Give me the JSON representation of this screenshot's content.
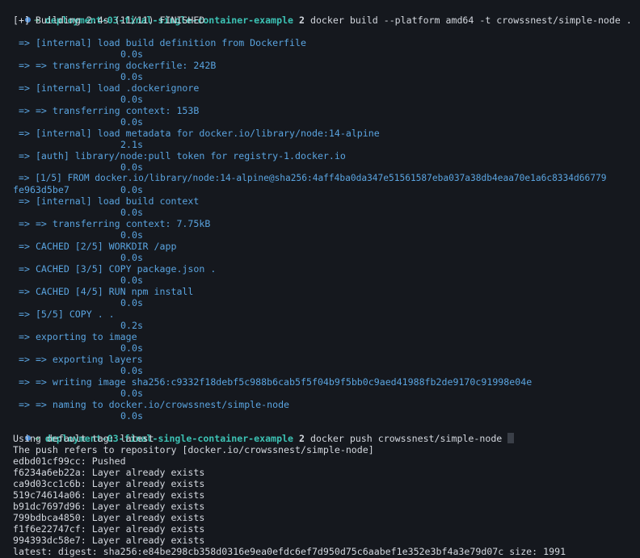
{
  "prompt1": {
    "arrow": "➜",
    "directory": "deployment-03-final-single-container-example",
    "git_branch_num": "2",
    "command": "docker build --platform amd64 -t crowssnest/simple-node ."
  },
  "build_status": "[+] Building 2.4s (11/11) FINISHED",
  "build_steps": [
    {
      "text": "=> [internal] load build definition from Dockerfile",
      "time": "0.0s"
    },
    {
      "text": "=> => transferring dockerfile: 242B",
      "time": "0.0s"
    },
    {
      "text": "=> [internal] load .dockerignore",
      "time": "0.0s"
    },
    {
      "text": "=> => transferring context: 153B",
      "time": "0.0s"
    },
    {
      "text": "=> [internal] load metadata for docker.io/library/node:14-alpine",
      "time": "2.1s"
    },
    {
      "text": "=> [auth] library/node:pull token for registry-1.docker.io",
      "time": "0.0s"
    },
    {
      "text": "=> [1/5] FROM docker.io/library/node:14-alpine@sha256:4aff4ba0da347e51561587eba037a38db4eaa70e1a6c8334d66779",
      "cont": "fe963d5be7",
      "time": "0.0s"
    },
    {
      "text": "=> [internal] load build context",
      "time": "0.0s"
    },
    {
      "text": "=> => transferring context: 7.75kB",
      "time": "0.0s"
    },
    {
      "text": "=> CACHED [2/5] WORKDIR /app",
      "time": "0.0s"
    },
    {
      "text": "=> CACHED [3/5] COPY package.json .",
      "time": "0.0s"
    },
    {
      "text": "=> CACHED [4/5] RUN npm install",
      "time": "0.0s"
    },
    {
      "text": "=> [5/5] COPY . .",
      "time": "0.2s"
    },
    {
      "text": "=> exporting to image",
      "time": "0.0s"
    },
    {
      "text": "=> => exporting layers",
      "time": "0.0s"
    },
    {
      "text": "=> => writing image sha256:c9332f18debf5c988b6cab5f5f04b9f5bb0c9aed41988fb2de9170c91998e04e",
      "time": "0.0s"
    },
    {
      "text": "=> => naming to docker.io/crowssnest/simple-node",
      "time": "0.0s"
    }
  ],
  "prompt2": {
    "arrow": "➜",
    "directory": "deployment-03-final-single-container-example",
    "git_branch_num": "2",
    "command": "docker push crowssnest/simple-node"
  },
  "push_output": [
    "Using default tag: latest",
    "The push refers to repository [docker.io/crowssnest/simple-node]",
    "edbd01cf99cc: Pushed",
    "f6234a6eb22a: Layer already exists",
    "ca9d03cc1c6b: Layer already exists",
    "519c74614a06: Layer already exists",
    "b91dc7697d96: Layer already exists",
    "799bdbca4850: Layer already exists",
    "f1f6e22747cf: Layer already exists",
    "994393dc58e7: Layer already exists",
    "latest: digest: sha256:e84be298cb358d0316e9ea0efdc6ef7d950d75c6aabef1e352e3bf4a3e79d07c size: 1991"
  ]
}
